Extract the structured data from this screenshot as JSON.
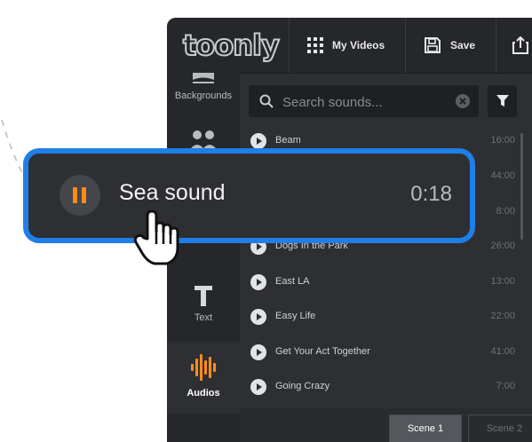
{
  "brand": {
    "logo_text": "toonly"
  },
  "topbar": {
    "my_videos": {
      "label": "My Videos",
      "icon": "grid-icon"
    },
    "save": {
      "label": "Save",
      "icon": "floppy-disk-icon"
    },
    "export_icon": "export-icon"
  },
  "sidebar": {
    "items": [
      {
        "label": "Backgrounds",
        "icon": "backgrounds-icon",
        "active": false
      },
      {
        "label": "",
        "icon": "characters-icon",
        "active": false
      },
      {
        "label": "Text",
        "icon": "text-icon",
        "active": false
      },
      {
        "label": "Audios",
        "icon": "audio-wave-icon",
        "active": true
      }
    ]
  },
  "search": {
    "placeholder": "Search sounds...",
    "value": ""
  },
  "sounds": [
    {
      "name": "Beam",
      "duration": "16:00"
    },
    {
      "name": "",
      "duration": "44:00"
    },
    {
      "name": "",
      "duration": "8:00"
    },
    {
      "name": "Dogs In the Park",
      "duration": "26:00"
    },
    {
      "name": "East LA",
      "duration": "13:00"
    },
    {
      "name": "Easy Life",
      "duration": "22:00"
    },
    {
      "name": "Get Your Act Together",
      "duration": "41:00"
    },
    {
      "name": "Going Crazy",
      "duration": "7:00"
    }
  ],
  "scenes": [
    {
      "label": "Scene 1",
      "active": true
    },
    {
      "label": "Scene 2",
      "active": false
    }
  ],
  "highlight": {
    "title": "Sea sound",
    "duration": "0:18",
    "state": "playing"
  },
  "colors": {
    "accent_blue": "#1e7fe6",
    "accent_orange": "#ff8c1a",
    "panel_bg": "#2e2f33",
    "topbar_bg": "#26272a"
  }
}
